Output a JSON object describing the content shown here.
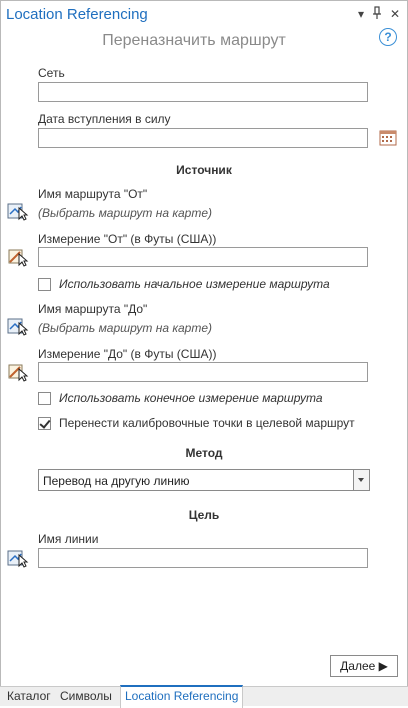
{
  "window": {
    "title": "Location Referencing",
    "dropdown_glyph": "▾",
    "pin_glyph": "📌",
    "close_glyph": "✕"
  },
  "heading": "Переназначить маршрут",
  "help_glyph": "?",
  "network": {
    "label": "Сеть",
    "value": ""
  },
  "effective_date": {
    "label": "Дата вступления в силу",
    "value": ""
  },
  "source": {
    "title": "Источник",
    "from_route_label": "Имя маршрута \"От\"",
    "from_route_hint": "(Выбрать маршрут на карте)",
    "from_measure_label": "Измерение \"От\" (в Футы (США))",
    "from_measure_value": "",
    "use_start_measure": {
      "label": "Использовать начальное измерение маршрута",
      "checked": false
    },
    "to_route_label": "Имя маршрута \"До\"",
    "to_route_hint": "(Выбрать маршрут на карте)",
    "to_measure_label": "Измерение \"До\" (в Футы (США))",
    "to_measure_value": "",
    "use_end_measure": {
      "label": "Использовать конечное измерение маршрута",
      "checked": false
    },
    "transfer_calibration": {
      "label": "Перенести калибровочные точки в целевой маршрут",
      "checked": true
    }
  },
  "method": {
    "title": "Метод",
    "selected": "Перевод на другую линию"
  },
  "target": {
    "title": "Цель",
    "line_name_label": "Имя линии",
    "line_name_value": ""
  },
  "next_button": "Далее ▶",
  "tabs": [
    {
      "label": "Каталог",
      "active": false
    },
    {
      "label": "Символы",
      "active": false
    },
    {
      "label": "Location Referencing",
      "active": true
    }
  ],
  "colors": {
    "accent": "#1f6fbf",
    "help": "#3a8fd6"
  },
  "icons": [
    "map-select-icon",
    "measure-select-icon",
    "calendar-icon",
    "help-icon"
  ]
}
